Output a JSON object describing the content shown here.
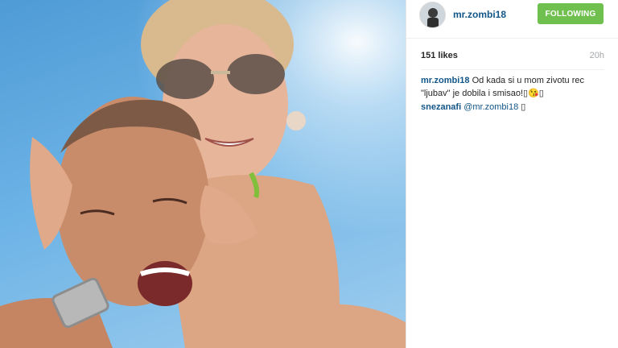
{
  "post": {
    "username": "mr.zombi18",
    "follow_label": "Following",
    "likes": "151 likes",
    "time": "20h"
  },
  "comments": [
    {
      "user": "mr.zombi18",
      "text": "Od kada si u mom zivotu rec \"ljubav\" je dobila i smisao!▯😘▯"
    },
    {
      "user": "snezanafi",
      "mention": "@mr.zombi18",
      "text": "▯"
    }
  ],
  "colors": {
    "link": "#125688",
    "follow_button": "#70c050",
    "timestamp": "#a5a7aa"
  },
  "icons": {
    "avatar": "profile-photo"
  }
}
